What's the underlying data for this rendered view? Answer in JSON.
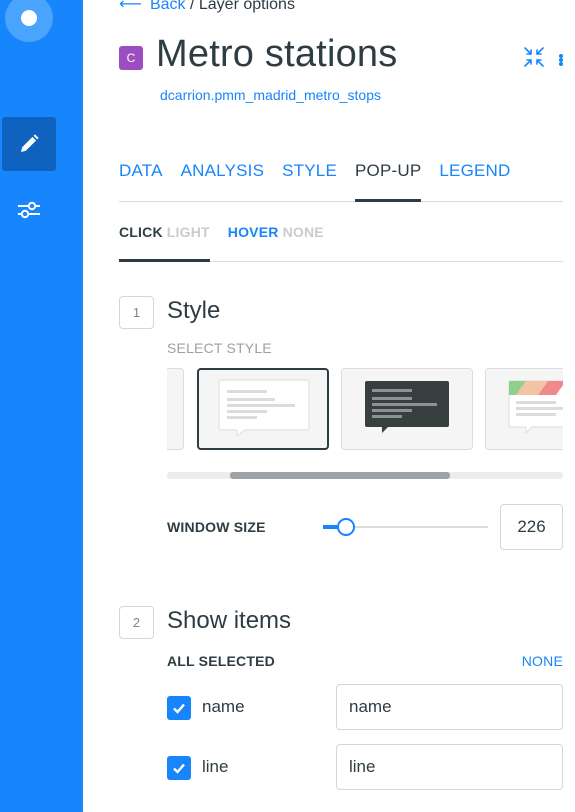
{
  "rail": {
    "items": [
      {
        "name": "edit",
        "icon": "pencil-icon",
        "active": true
      },
      {
        "name": "settings",
        "icon": "sliders-icon",
        "active": false
      }
    ]
  },
  "header": {
    "back_label": "Back",
    "separator": "/",
    "crumb": "Layer options",
    "layer_letter": "C",
    "layer_color": "#9c4ec0",
    "title": "Metro stations",
    "dataset": "dcarrion.pmm_madrid_metro_stops"
  },
  "tabs": [
    {
      "label": "DATA",
      "active": false
    },
    {
      "label": "ANALYSIS",
      "active": false
    },
    {
      "label": "STYLE",
      "active": false
    },
    {
      "label": "POP-UP",
      "active": true
    },
    {
      "label": "LEGEND",
      "active": false
    }
  ],
  "subtabs": {
    "click": {
      "key": "CLICK",
      "value": "LIGHT"
    },
    "hover": {
      "key": "HOVER",
      "value": "NONE"
    }
  },
  "style_section": {
    "step": "1",
    "title": "Style",
    "caption": "SELECT STYLE",
    "cards": [
      "none",
      "light",
      "dark",
      "header"
    ],
    "selected_card": "light",
    "window_size_label": "WINDOW SIZE",
    "window_size_value": "226",
    "slider_fraction": 0.14
  },
  "items_section": {
    "step": "2",
    "title": "Show items",
    "all_selected_label": "ALL SELECTED",
    "none_label": "NONE",
    "rows": [
      {
        "checked": true,
        "label": "name",
        "value": "name"
      },
      {
        "checked": true,
        "label": "line",
        "value": "line"
      }
    ]
  },
  "colors": {
    "accent": "#1785fb",
    "rail_active": "#0f63be",
    "text": "#2e3c43"
  }
}
